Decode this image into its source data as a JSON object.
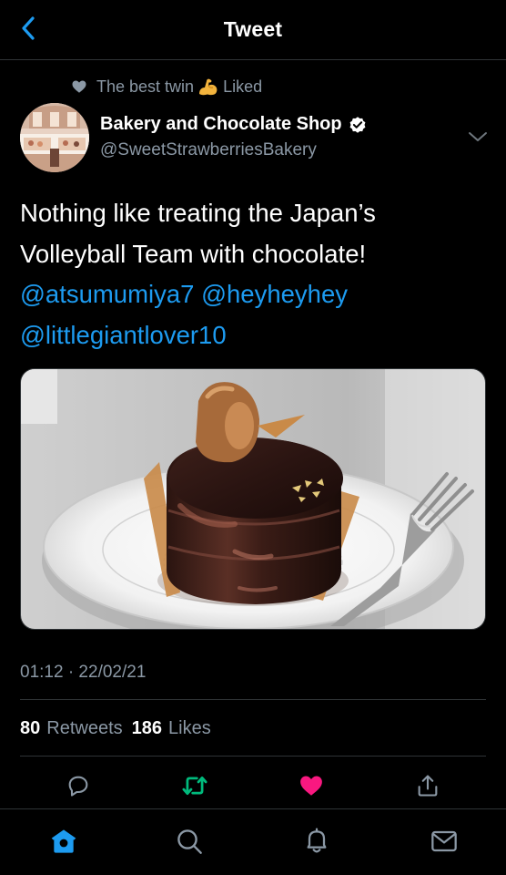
{
  "header": {
    "title": "Tweet"
  },
  "social_context": {
    "text": "The best twin",
    "suffix": "Liked",
    "emoji_icon": "flexed-biceps-emoji",
    "icon": "heart-icon"
  },
  "author": {
    "name": "Bakery and Chocolate Shop",
    "handle": "@SweetStrawberriesBakery",
    "verified": true
  },
  "tweet": {
    "lines": [
      "Nothing like treating the Japan’s",
      "Volleyball Team with chocolate!"
    ],
    "mentions": [
      "@atsumumiya7",
      "@heyheyhey",
      "@littlegiantlover10"
    ]
  },
  "timestamp": "01:12 · 22/02/21",
  "stats": {
    "retweets_count": "80",
    "retweets_label": "Retweets",
    "likes_count": "186",
    "likes_label": "Likes"
  },
  "actions": [
    {
      "name": "reply",
      "icon": "reply-icon",
      "color": "#8b98a5"
    },
    {
      "name": "retweet",
      "icon": "retweet-icon",
      "color": "#00ba7c",
      "active": true
    },
    {
      "name": "like",
      "icon": "heart-icon",
      "color": "#f91880",
      "active": true
    },
    {
      "name": "share",
      "icon": "share-icon",
      "color": "#8b98a5"
    }
  ],
  "tabbar": [
    {
      "name": "home",
      "icon": "home-icon",
      "active": true,
      "color": "#1d9bf0"
    },
    {
      "name": "search",
      "icon": "search-icon",
      "active": false
    },
    {
      "name": "notifications",
      "icon": "bell-icon",
      "active": false
    },
    {
      "name": "messages",
      "icon": "mail-icon",
      "active": false
    }
  ],
  "colors": {
    "accent": "#1d9bf0",
    "secondary_text": "#8b98a5",
    "divider": "#2f3336",
    "background": "#000000"
  }
}
